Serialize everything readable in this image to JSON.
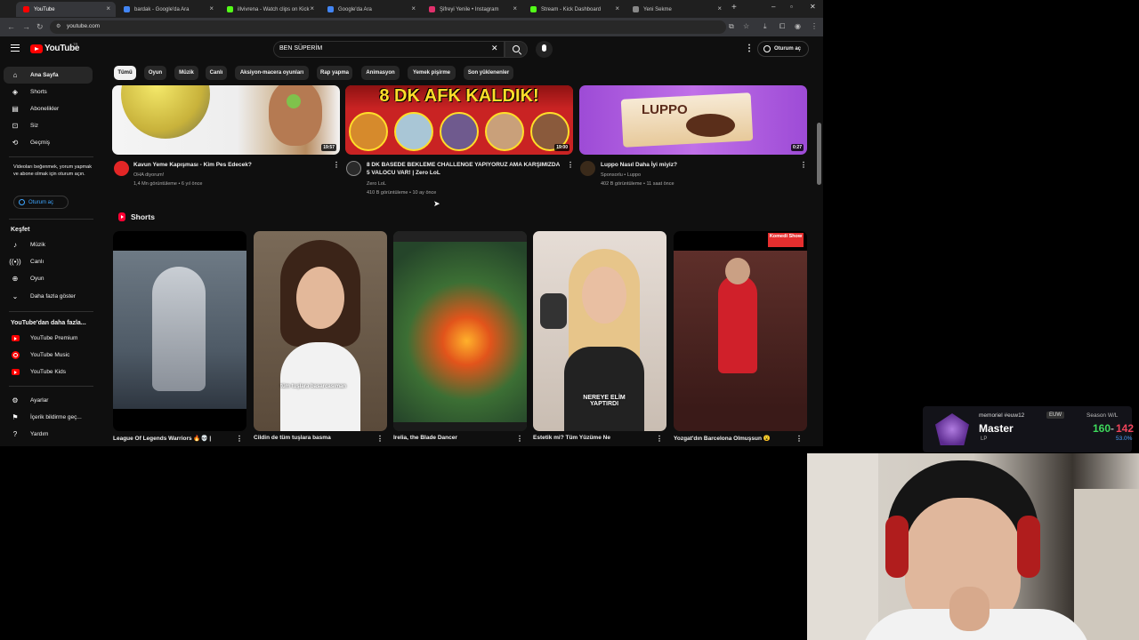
{
  "browser": {
    "tabs": [
      {
        "label": "YouTube",
        "active": true,
        "color": "#ff0000"
      },
      {
        "label": "bardak - Google'da Ara",
        "active": false,
        "color": "#4285f4"
      },
      {
        "label": "illvivrena - Watch clips on Kick",
        "active": false,
        "color": "#53fc18"
      },
      {
        "label": "Google'da Ara",
        "active": false,
        "color": "#4285f4"
      },
      {
        "label": "Şifreyi Yenile • Instagram",
        "active": false,
        "color": "#e1306c"
      },
      {
        "label": "Stream - Kick Dashboard",
        "active": false,
        "color": "#53fc18"
      },
      {
        "label": "Yeni Sekme",
        "active": false,
        "color": "#888888"
      }
    ],
    "url": "youtube.com"
  },
  "header": {
    "logo_text": "YouTube",
    "country_code": "TR",
    "search_value": "BEN SÜPERİM",
    "signin_label": "Oturum aç"
  },
  "chips": [
    "Tümü",
    "Oyun",
    "Müzik",
    "Canlı",
    "Aksiyon-macera oyunları",
    "Rap yapma",
    "Animasyon",
    "Yemek pişirme",
    "Son yüklenenler"
  ],
  "sidebar": {
    "main": [
      "Ana Sayfa",
      "Shorts",
      "Abonelikler",
      "Siz",
      "Geçmiş"
    ],
    "note": "Videoları beğenmek, yorum yapmak ve abone olmak için oturum açın.",
    "signin_label": "Oturum aç",
    "explore_heading": "Keşfet",
    "explore": [
      "Müzik",
      "Canlı",
      "Oyun",
      "Daha fazla göster"
    ],
    "more_heading": "YouTube'dan daha fazla...",
    "more": [
      "YouTube Premium",
      "YouTube Music",
      "YouTube Kids"
    ],
    "bottom": [
      "Ayarlar",
      "İçerik bildirme geç...",
      "Yardım"
    ]
  },
  "videos": [
    {
      "title": "Kavun Yeme Kapışması - Kim Pes Edecek?",
      "channel": "OHA diyorum!",
      "meta": "1,4 Mn görüntüleme • 6 yıl önce",
      "duration": "19:57"
    },
    {
      "title": "8 DK BASEDE BEKLEME CHALLENGE YAPIYORUZ AMA KARŞIMIZDA 5 VALOCU VAR! | Zero LoL",
      "channel": "Zero LoL",
      "meta": "410 B görüntüleme • 10 ay önce",
      "duration": "19:00",
      "thumb_text": "8 DK AFK KALDIK!"
    },
    {
      "title": "Luppo Nasıl Daha İyi miyiz?",
      "channel": "Sponsorlu • Luppo",
      "meta": "402 B görüntüleme • 11 saat önce",
      "duration": "0:27",
      "thumb_text": "LUPPO"
    }
  ],
  "shorts": {
    "heading": "Shorts",
    "items": [
      {
        "title": "League Of Legends Warriors 🔥💀 |"
      },
      {
        "title": "Cildin de tüm tuşlara basma",
        "caption": "tüm tuşlara basarcasıman"
      },
      {
        "title": "Irelia, the Blade Dancer"
      },
      {
        "title": "Estetik mi? Tüm Yüzüme Ne",
        "caption": "NEREYE ELİM YAPTIRDI"
      },
      {
        "title": "Yozgat'dın Barcelona Olmuşsun 😮",
        "caption": "Komedi Show"
      }
    ]
  },
  "stream_overlay": {
    "summoner": "memoriel #euw12",
    "region": "EUW",
    "rank": "Master",
    "lp": "LP",
    "season_label": "Season W/L",
    "wins": "160",
    "losses": "142",
    "winrate": "53.0%"
  }
}
